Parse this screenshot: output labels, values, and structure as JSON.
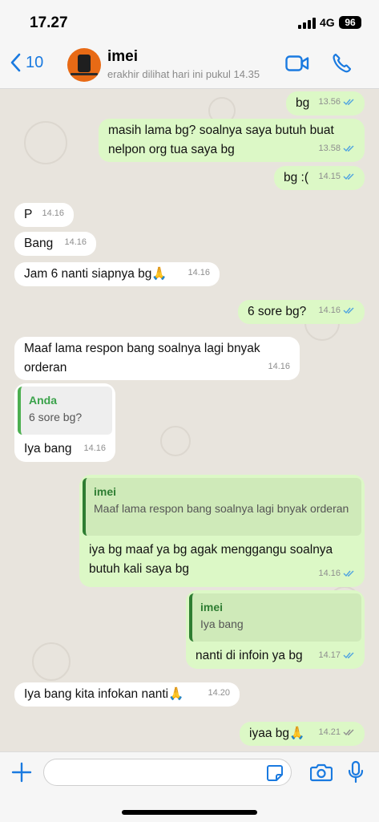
{
  "status_bar": {
    "time": "17.27",
    "network": "4G",
    "battery": "96"
  },
  "header": {
    "back_count": "10",
    "contact_name": "imei",
    "last_seen": "erakhir dilihat hari ini pukul 14.35"
  },
  "colors": {
    "accent": "#1a7ae0",
    "outgoing_bubble": "#dcf8c6",
    "incoming_bubble": "#ffffff",
    "chat_bg": "#e8e4dd",
    "read_tick": "#4fa3e0"
  },
  "messages": [
    {
      "dir": "out",
      "text": "bg",
      "time": "13.56",
      "ticks": "read"
    },
    {
      "dir": "out",
      "text": "masih lama bg? soalnya saya butuh buat nelpon org tua saya bg",
      "time": "13.58",
      "ticks": "read"
    },
    {
      "dir": "out",
      "text": "bg :(",
      "time": "14.15",
      "ticks": "read"
    },
    {
      "dir": "in",
      "text": "P",
      "time": "14.16"
    },
    {
      "dir": "in",
      "text": "Bang",
      "time": "14.16"
    },
    {
      "dir": "in",
      "text": "Jam 6 nanti siapnya bg🙏",
      "time": "14.16"
    },
    {
      "dir": "out",
      "text": "6 sore bg?",
      "time": "14.16",
      "ticks": "read"
    },
    {
      "dir": "in",
      "text": "Maaf lama respon bang soalnya lagi bnyak orderan",
      "time": "14.16"
    },
    {
      "dir": "in",
      "quote_name": "Anda",
      "quote_text": "6 sore bg?",
      "text": "Iya bang",
      "time": "14.16"
    },
    {
      "dir": "out",
      "quote_name": "imei",
      "quote_text": "Maaf lama respon bang soalnya lagi bnyak orderan",
      "text": "iya bg maaf ya bg agak menggangu soalnya butuh kali saya bg",
      "time": "14.16",
      "ticks": "read"
    },
    {
      "dir": "out",
      "quote_name": "imei",
      "quote_text": "Iya bang",
      "text": "nanti di infoin ya bg",
      "time": "14.17",
      "ticks": "read"
    },
    {
      "dir": "in",
      "text": "Iya bang kita infokan nanti🙏",
      "time": "14.20"
    },
    {
      "dir": "out",
      "text": "iyaa bg🙏",
      "time": "14.21",
      "ticks": "sent"
    }
  ],
  "composer": {
    "placeholder": ""
  },
  "icons": [
    "back-chevron-icon",
    "video-call-icon",
    "phone-icon",
    "plus-icon",
    "sticker-icon",
    "camera-icon",
    "microphone-icon",
    "double-check-icon"
  ]
}
